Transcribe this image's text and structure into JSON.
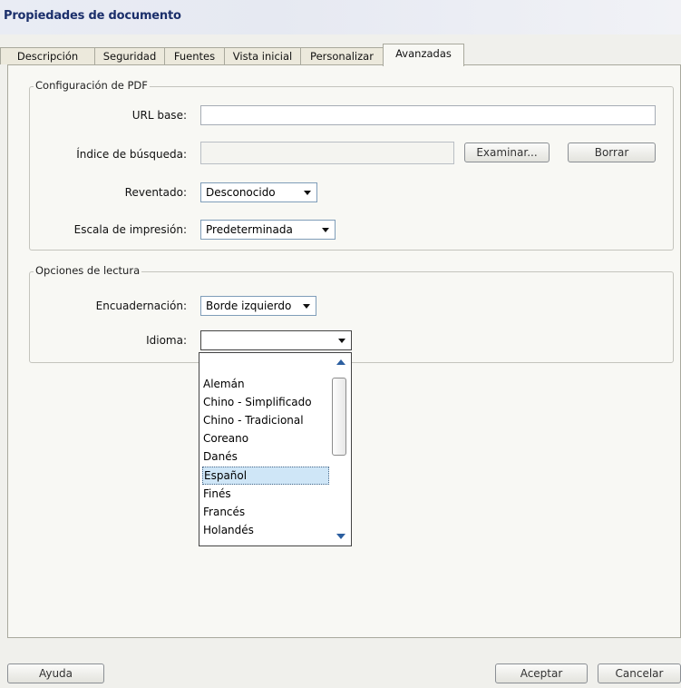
{
  "window": {
    "title": "Propiedades de documento"
  },
  "tabs": [
    {
      "label": "Descripción"
    },
    {
      "label": "Seguridad"
    },
    {
      "label": "Fuentes"
    },
    {
      "label": "Vista inicial"
    },
    {
      "label": "Personalizar"
    },
    {
      "label": "Avanzadas",
      "active": true
    }
  ],
  "pdf_config": {
    "legend": "Configuración de PDF",
    "url_base_label": "URL base:",
    "url_base_value": "",
    "search_index_label": "Índice de búsqueda:",
    "search_index_value": "",
    "browse_button": "Examinar...",
    "clear_button": "Borrar",
    "trapped_label": "Reventado:",
    "trapped_value": "Desconocido",
    "print_scale_label": "Escala de impresión:",
    "print_scale_value": "Predeterminada"
  },
  "reading_options": {
    "legend": "Opciones de lectura",
    "binding_label": "Encuadernación:",
    "binding_value": "Borde izquierdo",
    "language_label": "Idioma:",
    "language_value": "",
    "language_options": [
      "Alemán",
      "Chino - Simplificado",
      "Chino - Tradicional",
      "Coreano",
      "Danés",
      "Español",
      "Finés",
      "Francés",
      "Holandés"
    ],
    "selected_option": "Español"
  },
  "footer": {
    "help_button": "Ayuda",
    "ok_button": "Aceptar",
    "cancel_button": "Cancelar"
  },
  "colors": {
    "title": "#1b2f6b",
    "selection": "#cfe6f7",
    "scroll_arrow": "#2c5fa0"
  }
}
